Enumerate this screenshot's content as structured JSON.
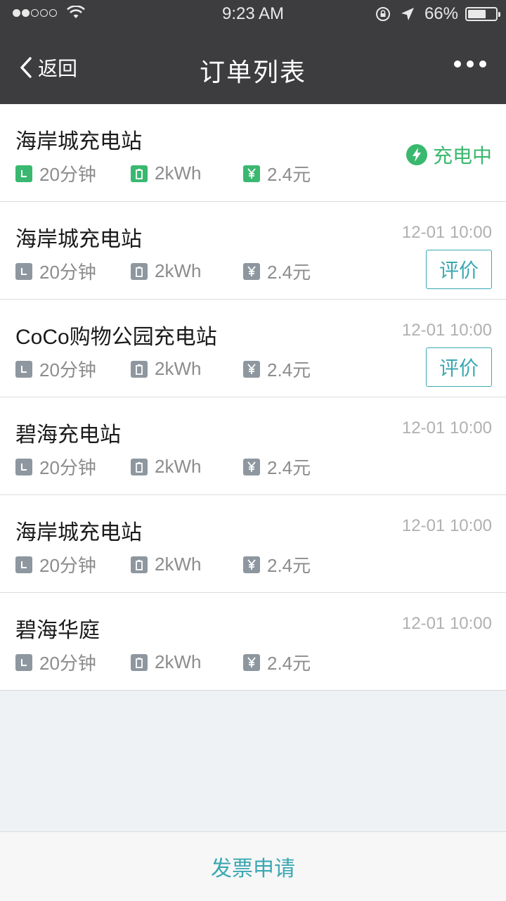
{
  "status_bar": {
    "signal_filled": 2,
    "signal_total": 5,
    "time": "9:23 AM",
    "battery_pct_text": "66%",
    "battery_level": 0.66
  },
  "nav": {
    "back_label": "返回",
    "title": "订单列表"
  },
  "orders": [
    {
      "station": "海岸城充电站",
      "duration": "20分钟",
      "energy": "2kWh",
      "cost": "2.4元",
      "time": "",
      "status": "充电中",
      "action": ""
    },
    {
      "station": "海岸城充电站",
      "duration": "20分钟",
      "energy": "2kWh",
      "cost": "2.4元",
      "time": "12-01 10:00",
      "status": "",
      "action": "评价"
    },
    {
      "station": "CoCo购物公园充电站",
      "duration": "20分钟",
      "energy": "2kWh",
      "cost": "2.4元",
      "time": "12-01 10:00",
      "status": "",
      "action": "评价"
    },
    {
      "station": "碧海充电站",
      "duration": "20分钟",
      "energy": "2kWh",
      "cost": "2.4元",
      "time": "12-01 10:00",
      "status": "",
      "action": ""
    },
    {
      "station": "海岸城充电站",
      "duration": "20分钟",
      "energy": "2kWh",
      "cost": "2.4元",
      "time": "12-01 10:00",
      "status": "",
      "action": ""
    },
    {
      "station": "碧海华庭",
      "duration": "20分钟",
      "energy": "2kWh",
      "cost": "2.4元",
      "time": "12-01 10:00",
      "status": "",
      "action": ""
    }
  ],
  "footer": {
    "invoice_label": "发票申请"
  },
  "colors": {
    "header_bg": "#3d3d3f",
    "accent_teal": "#3aa8b2",
    "charging_green": "#3ab86f",
    "icon_gray": "#8e979f"
  },
  "icons": {
    "duration": "clock-icon",
    "energy": "battery-icon",
    "cost": "yuan-icon",
    "charging": "lightning-icon"
  }
}
